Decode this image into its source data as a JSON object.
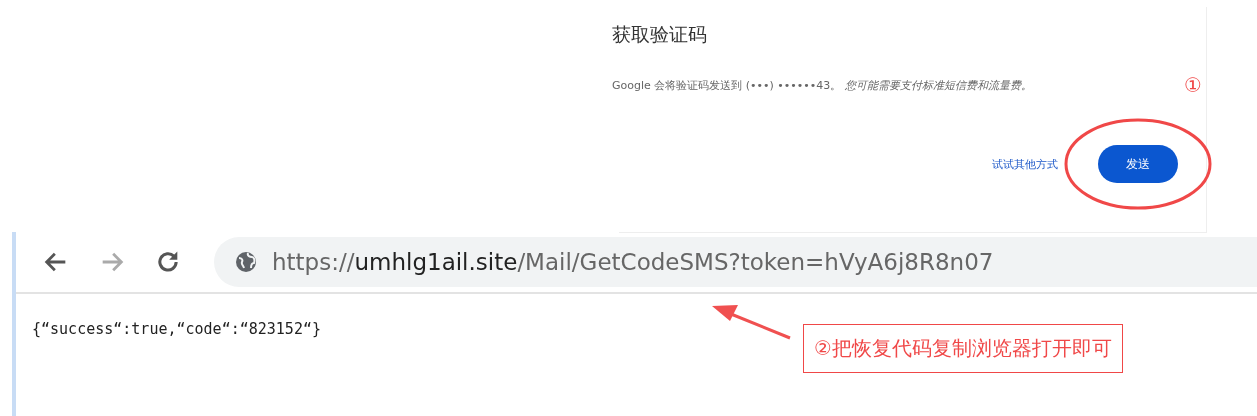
{
  "dialog": {
    "title": "获取验证码",
    "message": "Google 会将验证码发送到 (•••) ••••••43。 *您可能需要支付标准短信费和流量费。*",
    "buttons": [
      {
        "label": "试试其他方式",
        "kind": "text"
      },
      {
        "label": "发送",
        "kind": "filled"
      }
    ]
  },
  "annotations": [
    {
      "label": "①",
      "kind": "marker"
    },
    {
      "label": "②把恢复代码复制浏览器打开即可",
      "kind": "callout"
    }
  ],
  "browser": {
    "nav": [
      {
        "kind": "back",
        "disabled": false
      },
      {
        "kind": "forward",
        "disabled": true
      },
      {
        "kind": "reload",
        "disabled": false
      }
    ],
    "url": {
      "scheme": "https://",
      "host": "umhlg1ail.site",
      "path": "/Mail/GetCodeSMS?token=hVyA6j8R8n07"
    },
    "content": "{“success“:true,“code“:“823152“}"
  }
}
